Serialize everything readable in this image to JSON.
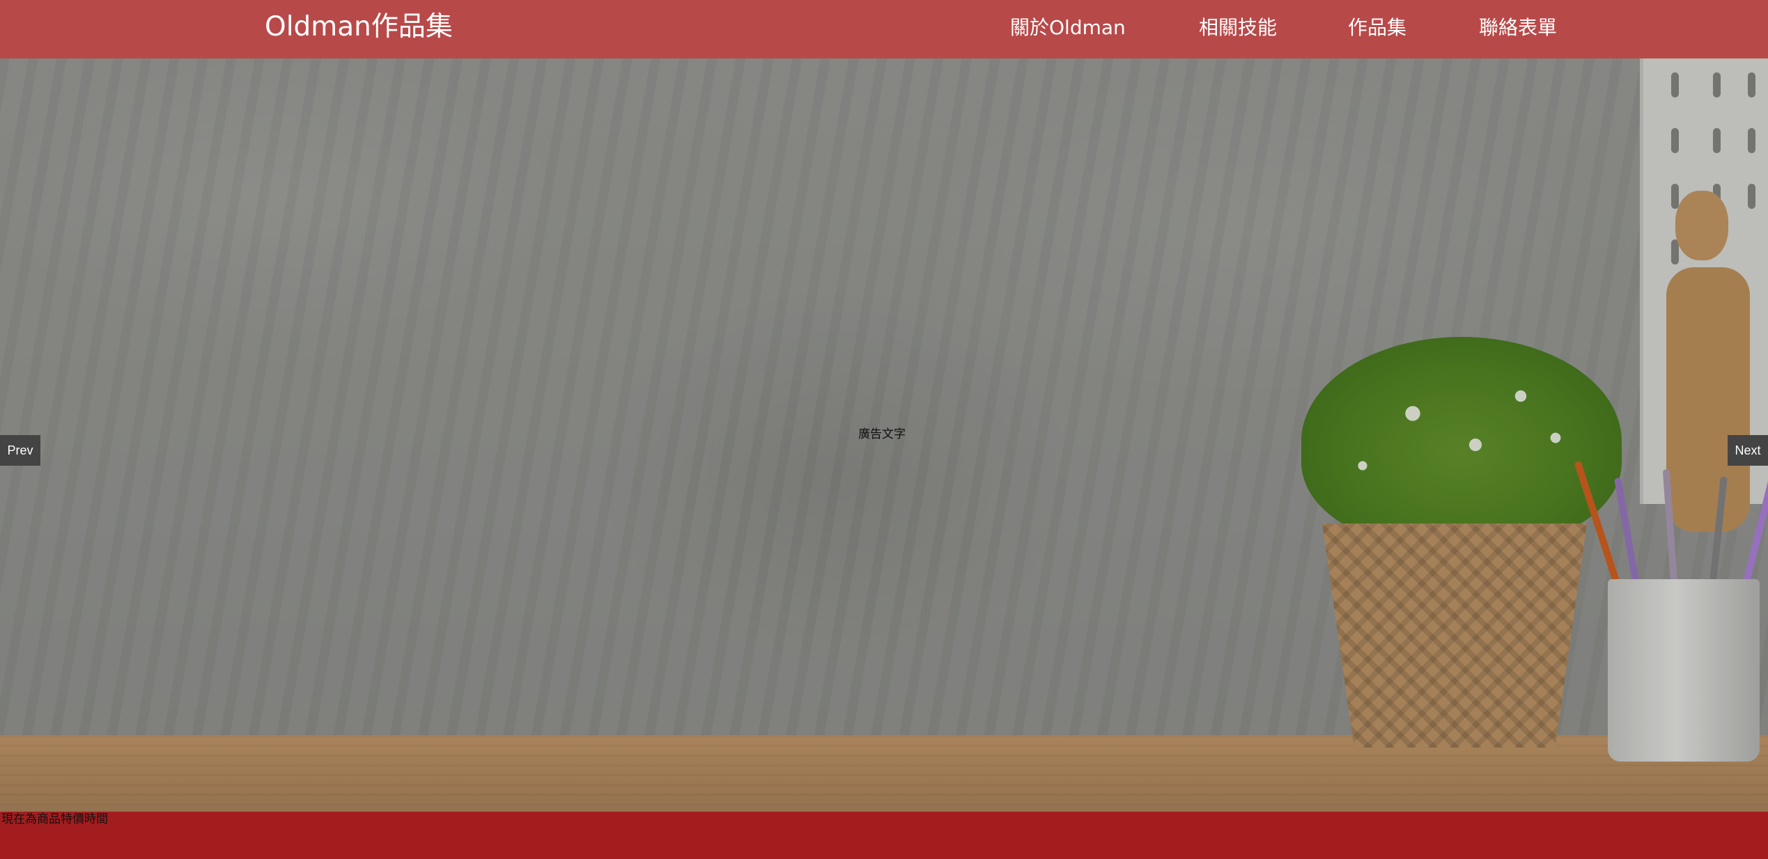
{
  "header": {
    "brand": "Oldman作品集",
    "nav": [
      "關於Oldman",
      "相關技能",
      "作品集",
      "聯絡表單"
    ]
  },
  "slider": {
    "caption": "廣告文字",
    "prev_label": "Prev",
    "next_label": "Next"
  },
  "promo": {
    "text": "現在為商品特價時間"
  },
  "colors": {
    "header_bg": "#b84949",
    "promo_bg": "#a31d1f",
    "slider_button_bg": "#444444"
  },
  "icons": [
    "wall-photo",
    "potted-plant",
    "brush-cup",
    "wooden-mannequin"
  ]
}
